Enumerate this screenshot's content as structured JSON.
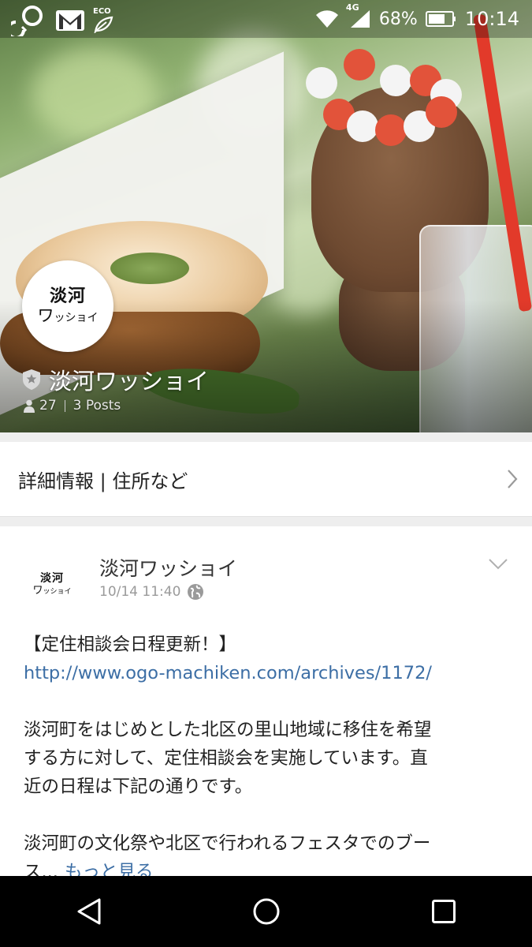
{
  "status_bar": {
    "eco_label": "ECO",
    "network": "4G",
    "battery": "68%",
    "time": "10:14",
    "icons": [
      "wifi-icon",
      "signal-icon",
      "battery-icon",
      "gmail-icon",
      "eco-leaf-icon",
      "sync-icon"
    ]
  },
  "page": {
    "logo_line1": "淡河",
    "logo_line2_big": "ワ",
    "logo_line2_small": "ッショイ",
    "name": "淡河ワッショイ",
    "followers": "27",
    "posts": "3 Posts"
  },
  "info": {
    "label": "詳細情報 | 住所など"
  },
  "post": {
    "author": "淡河ワッショイ",
    "timestamp": "10/14 11:40",
    "heading": "【定住相談会日程更新！】",
    "link": "http://www.ogo-machiken.com/archives/1172/",
    "paragraph1_line1": "淡河町をはじめとした北区の里山地域に移住を希望",
    "paragraph1_line2": "する方に対して、定住相談会を実施しています。直",
    "paragraph1_line3": "近の日程は下記の通りです。",
    "paragraph2_line1": "淡河町の文化祭や北区で行われるフェスタでのブー",
    "paragraph2_line2": "ス...",
    "more_label": "もっと見る"
  },
  "colors": {
    "link": "#3c6ea5",
    "nav_bg": "#000000",
    "divider": "#eeeeee"
  }
}
